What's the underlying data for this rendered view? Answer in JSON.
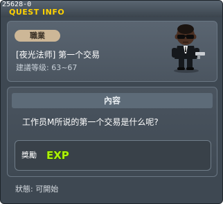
{
  "window": {
    "quest_id": "25628-0",
    "title": "QUEST INFO"
  },
  "quest": {
    "job_badge": "職業",
    "name": "[夜光法师] 第一个交易",
    "level": "建議等级: 63~67",
    "npc_icon": "npc-man-in-black-sprite"
  },
  "content": {
    "header": "內容",
    "text": "工作员M所说的第一个交易是什么呢?"
  },
  "reward": {
    "label": "獎勵",
    "icon": "exp-icon",
    "icon_text": "EXP"
  },
  "status": {
    "label": "狀態:",
    "value": "可開始"
  },
  "colors": {
    "title": "#ffd200",
    "badge_bg": "#cdb797",
    "exp_fill": "#aef00a"
  }
}
